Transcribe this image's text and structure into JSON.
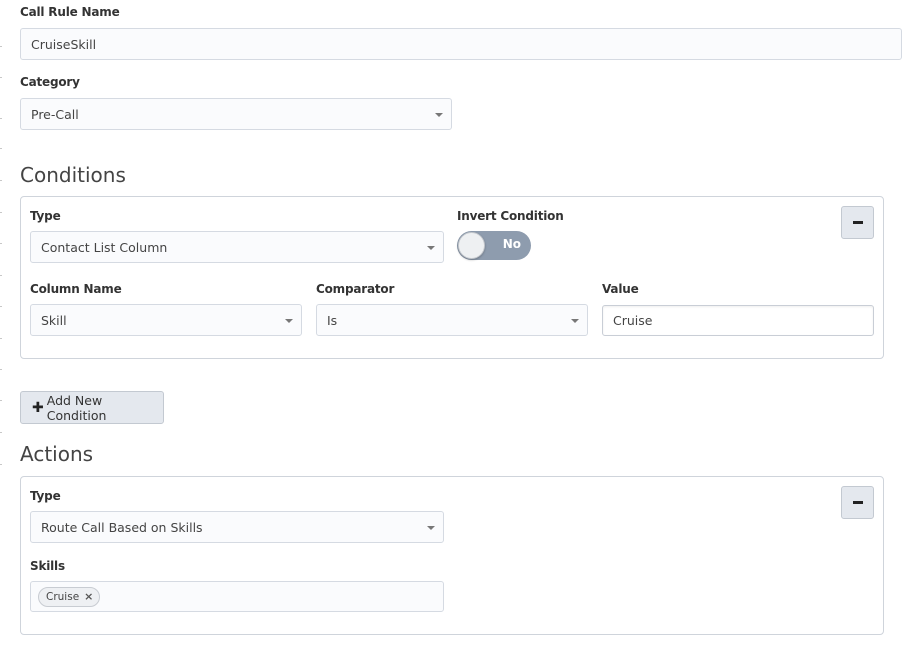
{
  "form": {
    "call_rule_name_label": "Call Rule Name",
    "call_rule_name_value": "CruiseSkill",
    "category_label": "Category",
    "category_value": "Pre-Call"
  },
  "conditions": {
    "title": "Conditions",
    "type_label": "Type",
    "type_value": "Contact List Column",
    "invert_label": "Invert Condition",
    "invert_value": "No",
    "column_name_label": "Column Name",
    "column_name_value": "Skill",
    "comparator_label": "Comparator",
    "comparator_value": "Is",
    "value_label": "Value",
    "value_value": "Cruise",
    "add_button_label": "Add New Condition"
  },
  "actions": {
    "title": "Actions",
    "type_label": "Type",
    "type_value": "Route Call Based on Skills",
    "skills_label": "Skills",
    "skills": [
      "Cruise"
    ],
    "tag_remove_glyph": "×"
  },
  "icons": {
    "plus": "✚",
    "remove": "minus-icon",
    "dropdown": "caret-down-icon"
  },
  "colors": {
    "toggle_off": "#8e9cae",
    "button_bg": "#e4e8ee",
    "border": "#cfd4db"
  }
}
